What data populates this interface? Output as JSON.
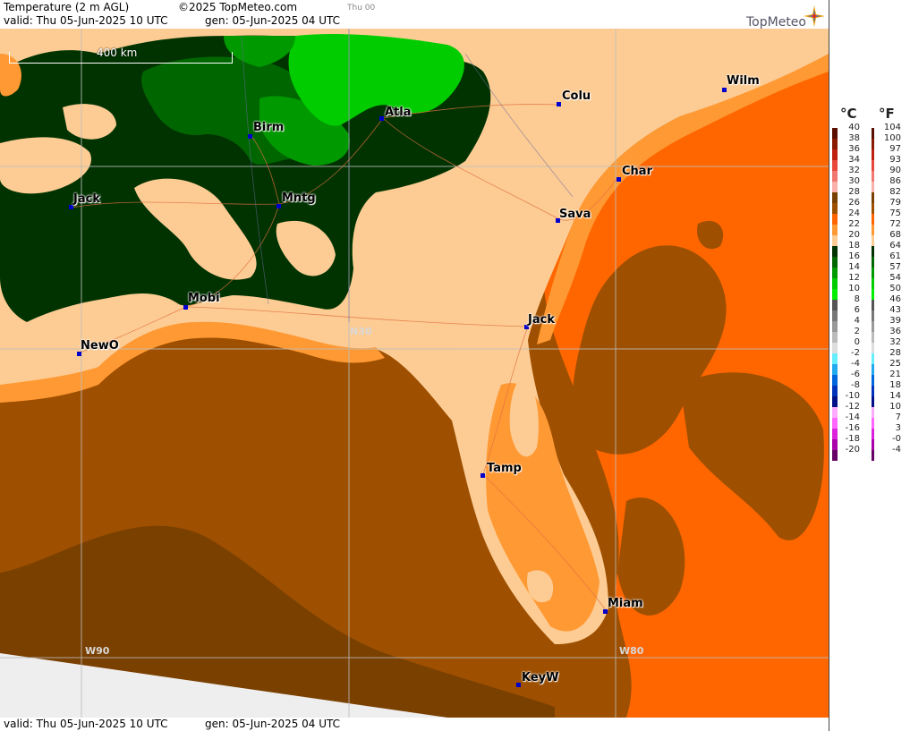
{
  "header": {
    "title": "Temperature (2 m AGL)",
    "copyright": "©2025 TopMeteo.com",
    "valid": "valid:  Thu  05-Jun-2025  10 UTC",
    "generated": "gen:  05-Jun-2025 04 UTC",
    "day": "Thu 00",
    "brand": "TopMeteo"
  },
  "footer": {
    "valid": "valid:  Thu  05-Jun-2025  10 UTC",
    "generated": "gen:  05-Jun-2025 04 UTC"
  },
  "map": {
    "scale_label": "400 km",
    "grid_labels": [
      "N30",
      "W90",
      "W80"
    ],
    "cities": [
      {
        "name": "Wilm"
      },
      {
        "name": "Colu"
      },
      {
        "name": "Atla"
      },
      {
        "name": "Birm"
      },
      {
        "name": "Char"
      },
      {
        "name": "Mntg"
      },
      {
        "name": "Jack"
      },
      {
        "name": "Sava"
      },
      {
        "name": "Mobi"
      },
      {
        "name": "Jack"
      },
      {
        "name": "NewO"
      },
      {
        "name": "Tamp"
      },
      {
        "name": "Miam"
      },
      {
        "name": "KeyW"
      }
    ]
  },
  "legend": {
    "celsius_label": "°C",
    "fahrenheit_label": "°F",
    "rows": [
      {
        "c": "40",
        "f": "104",
        "color": "#5a0f00"
      },
      {
        "c": "38",
        "f": "100",
        "color": "#8a1a00"
      },
      {
        "c": "36",
        "f": "97",
        "color": "#c02010"
      },
      {
        "c": "34",
        "f": "93",
        "color": "#e8483a"
      },
      {
        "c": "32",
        "f": "90",
        "color": "#f07870"
      },
      {
        "c": "30",
        "f": "86",
        "color": "#f8b0a8"
      },
      {
        "c": "28",
        "f": "82",
        "color": "#7a4000"
      },
      {
        "c": "26",
        "f": "79",
        "color": "#9e5000"
      },
      {
        "c": "24",
        "f": "75",
        "color": "#ff6600"
      },
      {
        "c": "22",
        "f": "72",
        "color": "#ff9933"
      },
      {
        "c": "20",
        "f": "68",
        "color": "#fdcc94"
      },
      {
        "c": "18",
        "f": "64",
        "color": "#003300"
      },
      {
        "c": "16",
        "f": "61",
        "color": "#006600"
      },
      {
        "c": "14",
        "f": "57",
        "color": "#009900"
      },
      {
        "c": "12",
        "f": "54",
        "color": "#00cc00"
      },
      {
        "c": "10",
        "f": "50",
        "color": "#00ee00"
      },
      {
        "c": "8",
        "f": "46",
        "color": "#555555"
      },
      {
        "c": "6",
        "f": "43",
        "color": "#777777"
      },
      {
        "c": "4",
        "f": "39",
        "color": "#999999"
      },
      {
        "c": "2",
        "f": "36",
        "color": "#bbbbbb"
      },
      {
        "c": "0",
        "f": "32",
        "color": "#dddddd"
      },
      {
        "c": "-2",
        "f": "28",
        "color": "#66eeff"
      },
      {
        "c": "-4",
        "f": "25",
        "color": "#22aaee"
      },
      {
        "c": "-6",
        "f": "21",
        "color": "#0066dd"
      },
      {
        "c": "-8",
        "f": "18",
        "color": "#0033bb"
      },
      {
        "c": "-10",
        "f": "14",
        "color": "#001188"
      },
      {
        "c": "-12",
        "f": "10",
        "color": "#ffaaff"
      },
      {
        "c": "-14",
        "f": "7",
        "color": "#ff66ff"
      },
      {
        "c": "-16",
        "f": "3",
        "color": "#dd22dd"
      },
      {
        "c": "-18",
        "f": "-0",
        "color": "#aa00aa"
      },
      {
        "c": "-20",
        "f": "-4",
        "color": "#660066"
      }
    ]
  }
}
